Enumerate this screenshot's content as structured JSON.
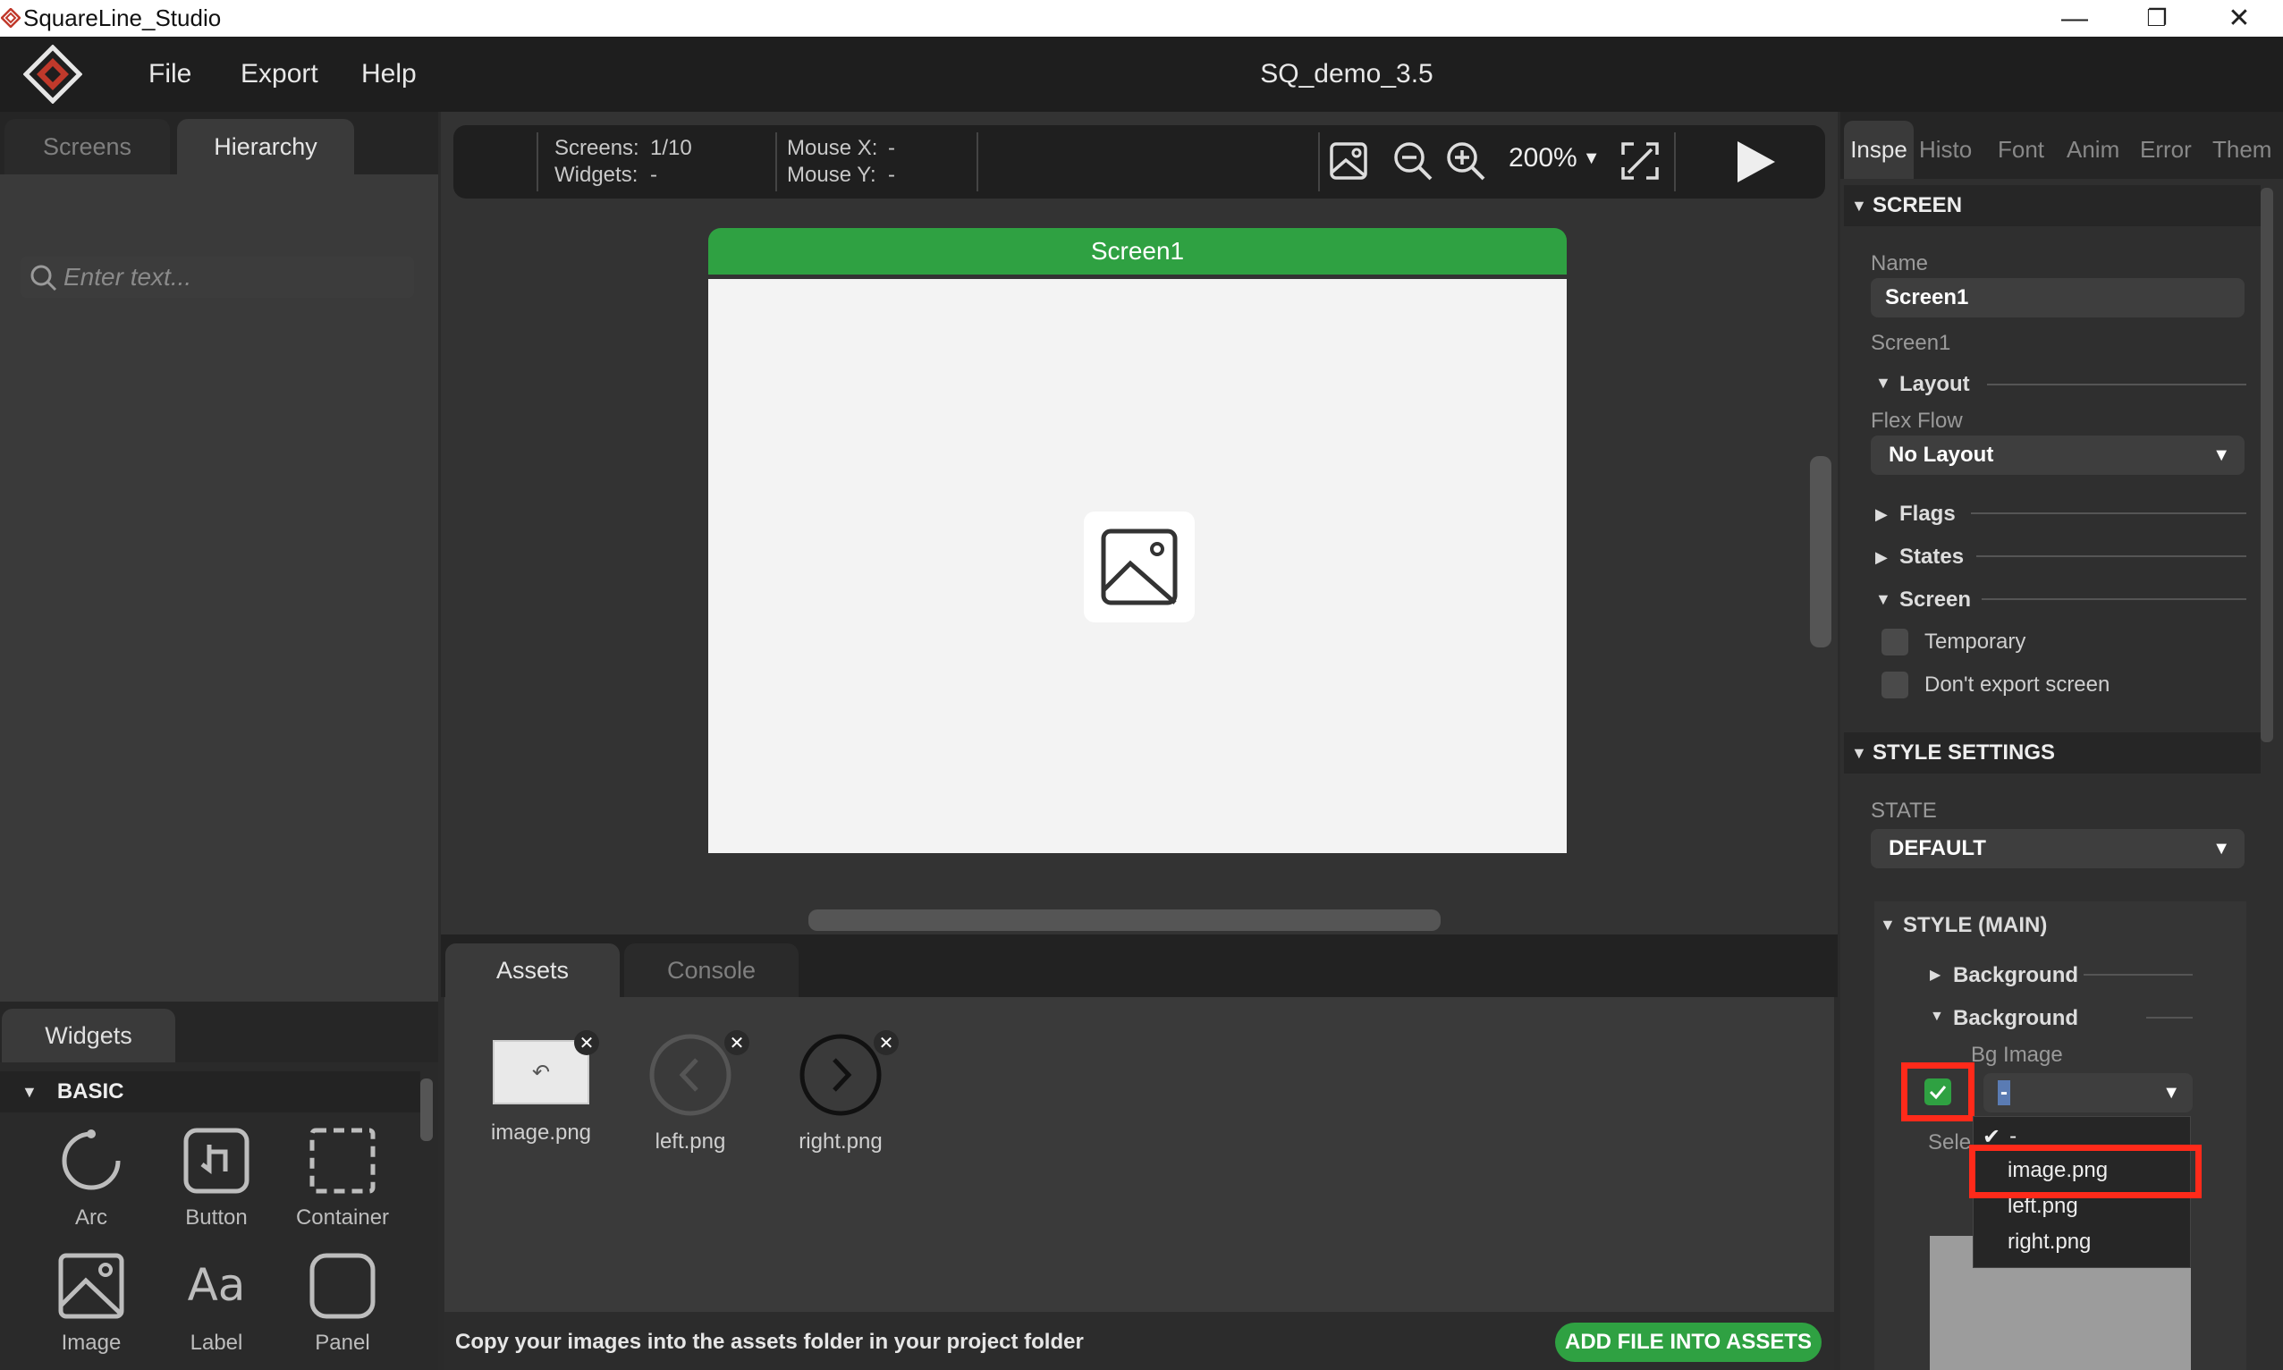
{
  "window": {
    "title": "SquareLine_Studio",
    "minimize": "—",
    "restore": "❐",
    "close": "✕"
  },
  "menu": {
    "items": [
      "File",
      "Export",
      "Help"
    ],
    "project_title": "SQ_demo_3.5"
  },
  "left": {
    "tabs": [
      "Screens",
      "Hierarchy"
    ],
    "active_tab": "Hierarchy",
    "search_placeholder": "Enter text...",
    "widgets_tab": "Widgets",
    "category": "BASIC",
    "widgets": [
      "Arc",
      "Button",
      "Container",
      "Image",
      "Label",
      "Panel"
    ]
  },
  "toolbar": {
    "screens_label": "Screens:",
    "screens_value": "1/10",
    "widgets_label": "Widgets:",
    "widgets_value": "-",
    "mousex_label": "Mouse X:",
    "mousex_value": "-",
    "mousey_label": "Mouse Y:",
    "mousey_value": "-",
    "zoom": "200%"
  },
  "canvas": {
    "screen_name": "Screen1"
  },
  "bottom": {
    "tabs": [
      "Assets",
      "Console"
    ],
    "active_tab": "Assets",
    "assets": [
      "image.png",
      "left.png",
      "right.png"
    ],
    "hint": "Copy your images into the assets folder in your project folder",
    "add_button": "ADD FILE INTO ASSETS"
  },
  "right": {
    "tabs": [
      "Inspe",
      "Histo",
      "Font",
      "Anim",
      "Error",
      "Them"
    ],
    "active_tab": "Inspe",
    "screen_section": "SCREEN",
    "name_label": "Name",
    "name_value": "Screen1",
    "name_hint": "Screen1",
    "layout_label": "Layout",
    "flex_flow_label": "Flex Flow",
    "flex_flow_value": "No Layout",
    "flags_label": "Flags",
    "states_label": "States",
    "screen_sub_label": "Screen",
    "temporary_label": "Temporary",
    "dont_export_label": "Don't export screen",
    "style_section": "STYLE SETTINGS",
    "state_label": "STATE",
    "state_value": "DEFAULT",
    "style_main": "STYLE (MAIN)",
    "background_1": "Background",
    "background_2": "Background",
    "bg_image_label": "Bg Image",
    "bg_image_value": "-",
    "select_label": "Sele",
    "dropdown_options": [
      "-",
      "image.png",
      "left.png",
      "right.png"
    ],
    "dropdown_selected": "-",
    "dropdown_highlighted": "image.png"
  },
  "colors": {
    "accent_green": "#2fa142",
    "highlight_red": "#ff2a1a"
  }
}
